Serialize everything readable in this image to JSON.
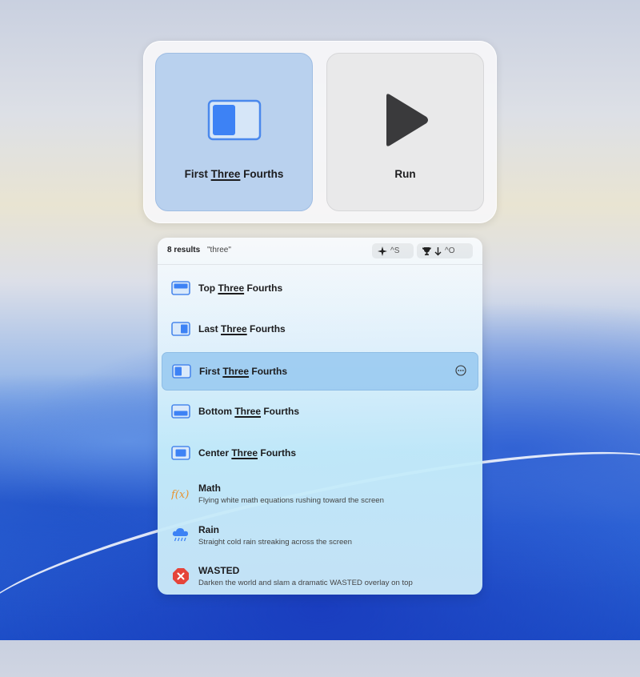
{
  "hud": {
    "tiles": [
      {
        "label_pre": "First ",
        "label_hl": "Three",
        "label_post": " Fourths",
        "icon": "first-three-fourths-icon"
      },
      {
        "label": "Run",
        "icon": "play-icon"
      }
    ]
  },
  "results": {
    "count": "8 results",
    "query": "\"three\"",
    "chip_ai": "^S",
    "chip_sort": "^O",
    "items": [
      {
        "pre": "Top ",
        "hl": "Three",
        "post": " Fourths",
        "icon": "top-three-fourths-icon"
      },
      {
        "pre": "Last ",
        "hl": "Three",
        "post": " Fourths",
        "icon": "last-three-fourths-icon"
      },
      {
        "pre": "First ",
        "hl": "Three",
        "post": " Fourths",
        "icon": "first-three-fourths-icon",
        "selected": true
      },
      {
        "pre": "Bottom ",
        "hl": "Three",
        "post": " Fourths",
        "icon": "bottom-three-fourths-icon"
      },
      {
        "pre": "Center ",
        "hl": "Three",
        "post": " Fourths",
        "icon": "center-three-fourths-icon"
      },
      {
        "title": "Math",
        "subtitle": "Flying white math equations rushing toward the screen",
        "icon": "function-icon"
      },
      {
        "title": "Rain",
        "subtitle": "Straight cold rain streaking across the screen",
        "icon": "rain-cloud-icon"
      },
      {
        "title": "WASTED",
        "subtitle": "Darken the world and slam a dramatic WASTED overlay on top",
        "icon": "wasted-x-icon"
      }
    ]
  },
  "colors": {
    "accent": "#3d82f5",
    "selected_row": "#a7d1f2",
    "wasted": "#e5443a",
    "math": "#e8922e"
  }
}
